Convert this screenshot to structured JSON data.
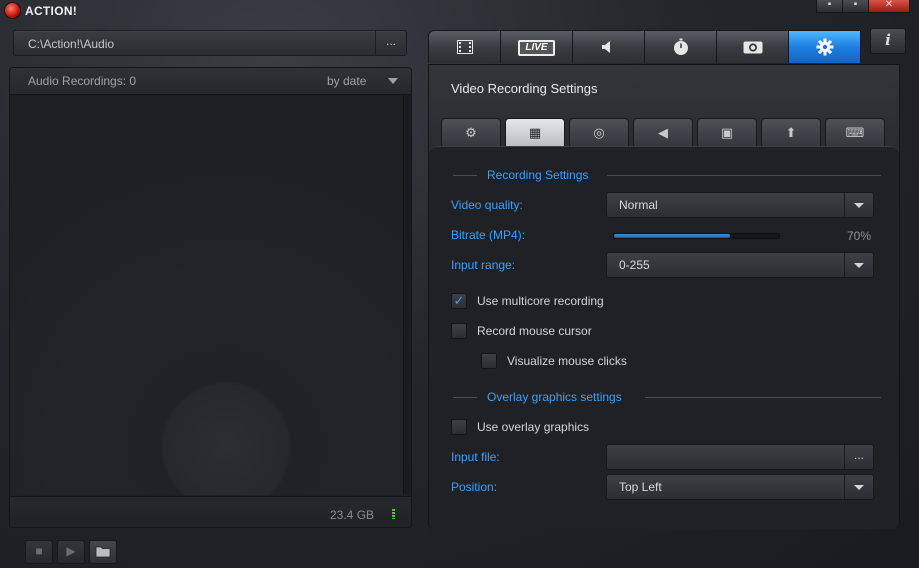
{
  "window": {
    "title": "ACTION!",
    "buttons": {
      "minimize": "▪",
      "restore": "▪",
      "close": "✕"
    }
  },
  "left": {
    "path": "C:\\Action!\\Audio",
    "browse_label": "...",
    "list_count": "Audio Recordings: 0",
    "sort_label": "by date",
    "disk_space": "23.4 GB",
    "transport": {
      "stop": "■",
      "play": "▶",
      "folder": "🗀"
    }
  },
  "top_tabs": [
    {
      "name": "video-tab",
      "icon": "film-icon",
      "glyph": "🎞"
    },
    {
      "name": "live-tab",
      "label": "LIVE"
    },
    {
      "name": "audio-tab",
      "icon": "speaker-icon",
      "glyph": "🔈"
    },
    {
      "name": "benchmark-tab",
      "icon": "stopwatch-icon",
      "glyph": "⏱"
    },
    {
      "name": "screenshot-tab",
      "icon": "camera-icon",
      "glyph": "◉"
    },
    {
      "name": "settings-tab",
      "icon": "gear-icon",
      "glyph": "⚙",
      "active": true
    }
  ],
  "info_label": "i",
  "settings": {
    "title": "Video Recording Settings",
    "sub_tabs": [
      {
        "icon": "gear-icon",
        "glyph": "⚙"
      },
      {
        "icon": "film-icon",
        "glyph": "▦",
        "active": true
      },
      {
        "icon": "webcam-icon",
        "glyph": "◎"
      },
      {
        "icon": "speaker-icon",
        "glyph": "◀"
      },
      {
        "icon": "monitor-icon",
        "glyph": "▣"
      },
      {
        "icon": "upload-icon",
        "glyph": "⬆"
      },
      {
        "icon": "keyboard-icon",
        "glyph": "⌨"
      }
    ],
    "recording_section": "Recording Settings",
    "video_quality_label": "Video quality:",
    "video_quality_value": "Normal",
    "bitrate_label": "Bitrate (MP4):",
    "bitrate_percent": 70,
    "bitrate_text": "70%",
    "input_range_label": "Input range:",
    "input_range_value": "0-255",
    "multicore_label": "Use multicore recording",
    "multicore_checked": true,
    "mouse_cursor_label": "Record mouse cursor",
    "mouse_cursor_checked": false,
    "mouse_clicks_label": "Visualize mouse clicks",
    "mouse_clicks_checked": false,
    "overlay_section": "Overlay graphics settings",
    "overlay_label": "Use overlay graphics",
    "overlay_checked": false,
    "input_file_label": "Input file:",
    "input_file_value": "",
    "input_file_browse": "...",
    "position_label": "Position:",
    "position_value": "Top Left"
  }
}
